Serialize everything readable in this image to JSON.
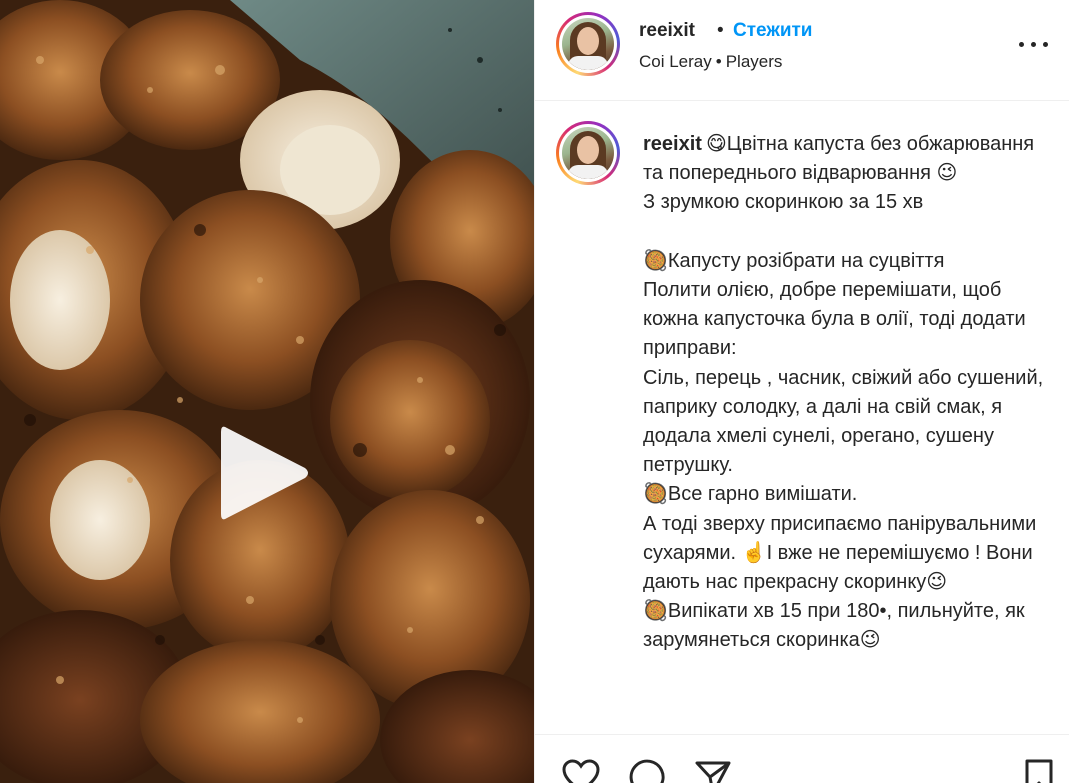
{
  "post": {
    "username": "reeixit",
    "separator": "•",
    "follow_label": "Стежити",
    "music": {
      "artist": "Coi Leray",
      "separator": "•",
      "track": "Players"
    },
    "more_label": "...",
    "caption_text": "😋Цвітна капуста без обжарювання та попереднього відварювання 😉\nЗ зрумкою скоринкою за 15 хв\n\n🥘Капусту розібрати на суцвіття\nПолити олією, добре перемішати, щоб кожна капусточка була в олії, тоді додати приправи:\nСіль, перець , часник, свіжий або сушений, паприку солодку, а далі на свій смак, я додала хмелі сунелі, орегано, сушену петрушку.\n🥘Все гарно вимішати.\nА тоді зверху присипаємо панірувальними сухарями. ☝️І вже не перемішуємо ! Вони дають нас прекрасну скоринку😉\n🥘Випікати хв 15 при 180•, пильнуйте, як зарумянеться скоринка😉"
  },
  "media": {
    "play_icon": "play-icon"
  },
  "actions": {
    "icons": [
      "heart-icon",
      "comment-icon",
      "share-icon",
      "bookmark-icon"
    ]
  },
  "colors": {
    "accent": "#0095f6",
    "text": "#262626",
    "border": "#efefef"
  }
}
